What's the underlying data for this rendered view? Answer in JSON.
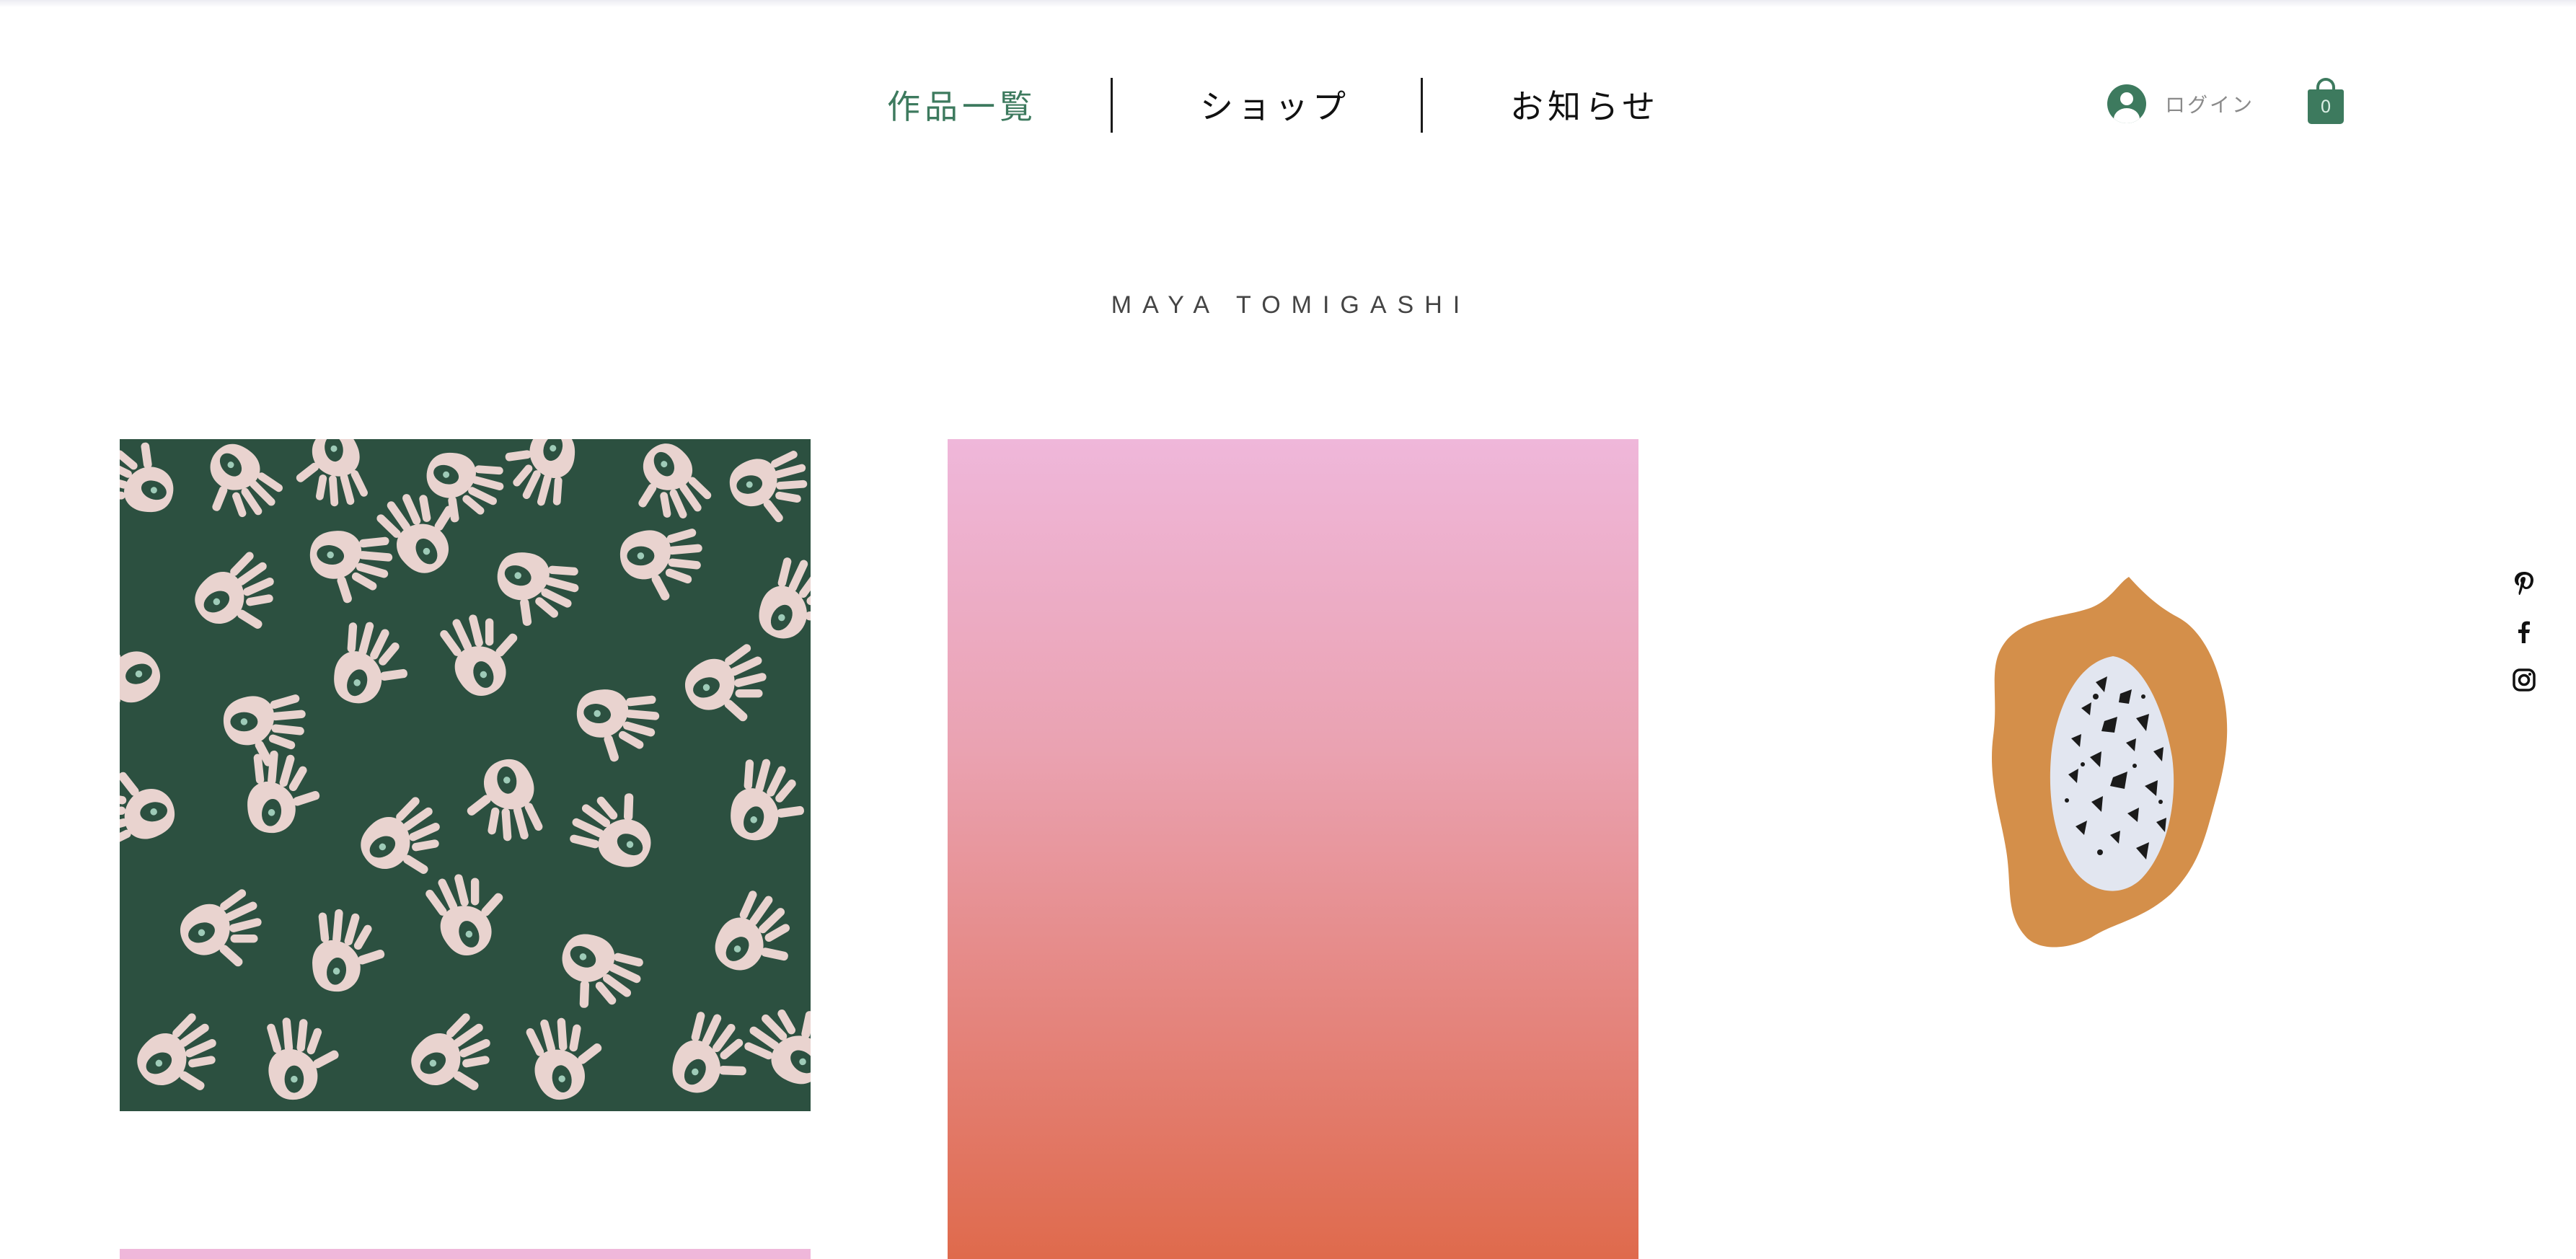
{
  "header": {
    "nav": [
      {
        "label": "作品一覧",
        "active": true
      },
      {
        "label": "ショップ",
        "active": false
      },
      {
        "label": "お知らせ",
        "active": false
      }
    ],
    "login_label": "ログイン",
    "cart_count": "0"
  },
  "site_title": "MAYA TOMIGASHI",
  "gallery": [
    {
      "icon": "hands-pattern-artwork"
    },
    {
      "icon": "pink-orange-gradient-artwork"
    },
    {
      "icon": "papaya-artwork"
    },
    {
      "icon": "pink-artwork-partial"
    }
  ],
  "social": [
    {
      "icon": "pinterest-icon"
    },
    {
      "icon": "facebook-icon"
    },
    {
      "icon": "instagram-icon"
    }
  ],
  "colors": {
    "accent_green": "#3d7a5e",
    "dark_green": "#2c5040",
    "pale_pink": "#e9d3cf",
    "papaya_orange": "#d48f4a",
    "papaya_flesh": "#e2e6f0",
    "gradient_top": "#efb7da",
    "gradient_bottom": "#df6a4c"
  }
}
